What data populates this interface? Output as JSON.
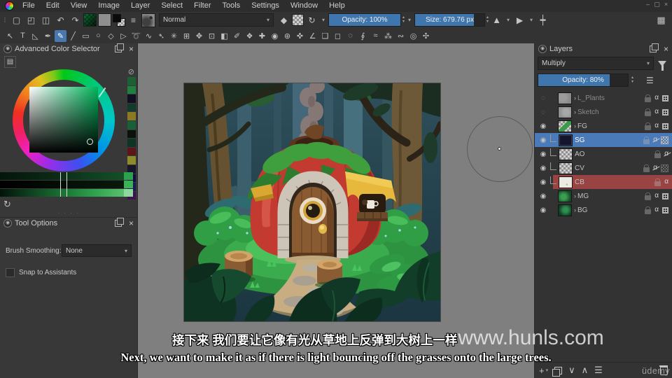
{
  "app": {
    "menus": [
      "File",
      "Edit",
      "View",
      "Image",
      "Layer",
      "Select",
      "Filter",
      "Tools",
      "Settings",
      "Window",
      "Help"
    ]
  },
  "window_controls": [
    {
      "name": "minimize",
      "glyph": "–"
    },
    {
      "name": "maximize",
      "glyph": "▢"
    },
    {
      "name": "close",
      "glyph": "×"
    }
  ],
  "glyphs": {
    "overflow": "⋮",
    "new_doc": "▢",
    "open_doc": "◰",
    "save_doc": "◫",
    "undo": "↶",
    "redo": "↷",
    "presets": "≡",
    "eraser": "◆",
    "reload": "↻",
    "caret": "▾",
    "spin_up": "▴",
    "spin_down": "▾",
    "mirror_h": "▲",
    "mirror_v": "▶",
    "crop": "┿",
    "workspace": "▦",
    "eye_visible": "◉",
    "eye_hidden": "◌",
    "group_arrow": "›",
    "alpha": "α",
    "hamburger": "☰",
    "plus": "+",
    "move_down": "∨",
    "move_up": "∧",
    "properties": "☰",
    "refresh": "↻",
    "block": "⊘",
    "close": "×",
    "dots": "· · · ·"
  },
  "toolbar": {
    "blend_mode": "Normal",
    "opacity_label": "Opacity: 100%",
    "opacity_pct": 100,
    "size_label": "Size: 679.76 px",
    "size_pct": 85,
    "accent": "#3f76ad"
  },
  "tools": [
    {
      "name": "select-shapes",
      "glyph": "↖"
    },
    {
      "name": "text",
      "glyph": "T"
    },
    {
      "name": "edit-shapes",
      "glyph": "◺"
    },
    {
      "name": "calligraphy",
      "glyph": "✒"
    },
    {
      "name": "freehand-brush",
      "glyph": "✎",
      "active": true
    },
    {
      "name": "line",
      "glyph": "╱"
    },
    {
      "name": "rectangle",
      "glyph": "▭"
    },
    {
      "name": "ellipse",
      "glyph": "○"
    },
    {
      "name": "polygon",
      "glyph": "◇"
    },
    {
      "name": "polyline",
      "glyph": "▷"
    },
    {
      "name": "bezier-curve",
      "glyph": "➰"
    },
    {
      "name": "freehand-path",
      "glyph": "∿"
    },
    {
      "name": "dynamic-brush",
      "glyph": "➴"
    },
    {
      "name": "multibrush",
      "glyph": "✳"
    },
    {
      "name": "transform",
      "glyph": "⊞"
    },
    {
      "name": "move",
      "glyph": "✥"
    },
    {
      "name": "crop-tool",
      "glyph": "⊡"
    },
    {
      "name": "gradient",
      "glyph": "◧"
    },
    {
      "name": "color-sampler",
      "glyph": "✐"
    },
    {
      "name": "pattern-edit",
      "glyph": "❖"
    },
    {
      "name": "smart-patch",
      "glyph": "✚"
    },
    {
      "name": "fill",
      "glyph": "◉"
    },
    {
      "name": "enclose-fill",
      "glyph": "⊛"
    },
    {
      "name": "assistants",
      "glyph": "✜"
    },
    {
      "name": "measure",
      "glyph": "∠"
    },
    {
      "name": "reference-images",
      "glyph": "❏"
    },
    {
      "name": "rect-select",
      "glyph": "◻"
    },
    {
      "name": "ellipse-select",
      "glyph": "◌"
    },
    {
      "name": "freehand-select",
      "glyph": "∮"
    },
    {
      "name": "similar-select",
      "glyph": "≈"
    },
    {
      "name": "contiguous-select",
      "glyph": "⁂"
    },
    {
      "name": "bezier-select",
      "glyph": "∾"
    },
    {
      "name": "zoom",
      "glyph": "◎"
    },
    {
      "name": "pan",
      "glyph": "✣"
    }
  ],
  "color_selector": {
    "title": "Advanced Color Selector",
    "history_swatches": [
      "#1e6034",
      "#208040",
      "#101022",
      "#123b2e",
      "#8a7a22",
      "#176038",
      "#0b110b",
      "#0e3524",
      "#5c161a",
      "#8c8c2c",
      "#16162c",
      "#101040",
      "#1a1a55",
      "#3c1254"
    ],
    "shade_strips": [
      {
        "gradient": "linear-gradient(to right,#03160a,#0c2a16 45%,#0f3d1f 70%,#144f28)",
        "end": "#2ea14e"
      },
      {
        "gradient": "linear-gradient(to right,#000000,#061006 60%,#0a180c)",
        "end": "#3bb258"
      },
      {
        "gradient": "linear-gradient(to right,#02130a,#1d7a38 55%,#2ea04c 75%,#59c06e)",
        "end": "#90d8a0"
      }
    ]
  },
  "tool_options": {
    "title": "Tool Options",
    "smoothing_label": "Brush Smoothing:",
    "smoothing_value": "None",
    "snap_label": "Snap to Assistants"
  },
  "layers_panel": {
    "title": "Layers",
    "blend_mode": "Multiply",
    "opacity_label": "Opacity: 80%",
    "opacity_pct": 80,
    "layers": [
      {
        "name": "L_Plants",
        "eye": "hidden",
        "kind": "group",
        "thumb": "gray",
        "icons": [
          "lock-dim",
          "alpha",
          "grid"
        ],
        "dim": true
      },
      {
        "name": "Sketch",
        "eye": "hidden",
        "kind": "group",
        "thumb": "gray2",
        "icons": [
          "lock-dim",
          "alpha",
          "grid"
        ],
        "dim": true
      },
      {
        "name": "FG",
        "eye": "visible",
        "kind": "group",
        "thumb": "fg",
        "icons": [
          "lock-dim",
          "alpha",
          "grid"
        ]
      },
      {
        "name": "SG",
        "eye": "visible",
        "kind": "paint",
        "thumb": "navy",
        "selected": true,
        "child": true,
        "icons": [
          "lock-dim",
          "alpha-strike",
          "checker"
        ]
      },
      {
        "name": "AO",
        "eye": "visible",
        "kind": "paint",
        "thumb": "checker",
        "child": true,
        "icons": [
          "lock-dim",
          "alpha-strike"
        ]
      },
      {
        "name": "CV",
        "eye": "visible",
        "kind": "paint",
        "thumb": "checker",
        "child": true,
        "icons": [
          "lock-dim",
          "alpha-strike",
          "checker-dim"
        ]
      },
      {
        "name": "CB",
        "eye": "visible",
        "kind": "paint",
        "thumb": "white",
        "red": true,
        "child": true,
        "icons": [
          "lock-dim",
          "alpha"
        ]
      },
      {
        "name": "MG",
        "eye": "visible",
        "kind": "group",
        "thumb": "mg",
        "icons": [
          "lock-dim",
          "alpha",
          "grid"
        ]
      },
      {
        "name": "BG",
        "eye": "visible",
        "kind": "group",
        "thumb": "bg",
        "icons": [
          "lock-dim",
          "alpha",
          "grid"
        ]
      }
    ]
  },
  "subtitles": {
    "chinese": "接下来 我们要让它像有光从草地上反弹到大树上一样",
    "english": "Next, we want to make it as if there is light bouncing off the grasses onto the large trees.",
    "site_watermark": "www.hunls.com",
    "corner_watermark": "üdemy"
  },
  "colors": {
    "accent_blue": "#3f76ad",
    "selected_layer": "#4a7ab8",
    "red_layer_label": "#9a4343",
    "canvas_gray": "#7f7f7f",
    "panel_bg": "#383838",
    "toolbar_bg": "#333333",
    "menubar_bg": "#2d2d2d"
  }
}
